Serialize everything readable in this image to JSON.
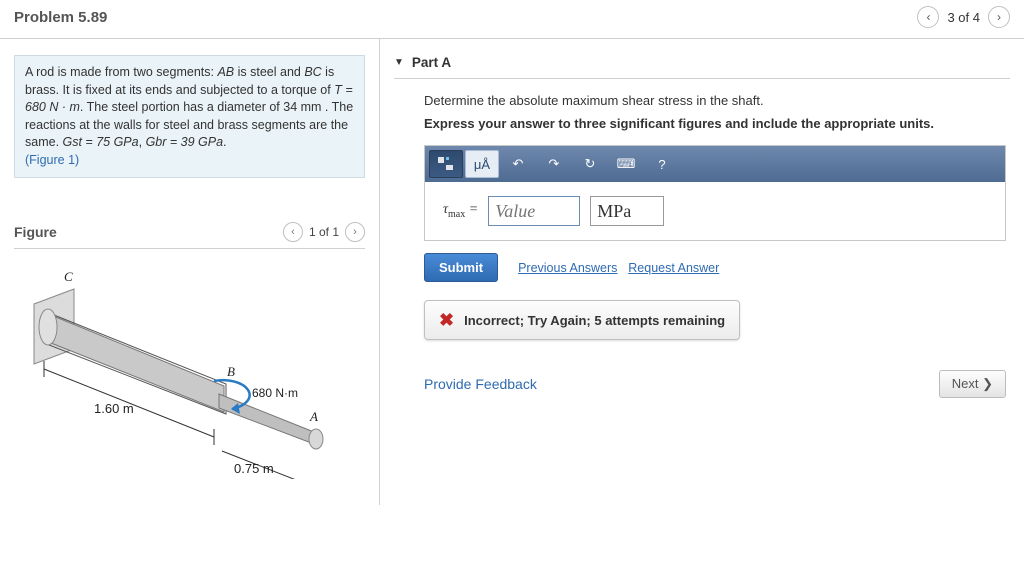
{
  "header": {
    "title": "Problem 5.89",
    "position": "3 of 4"
  },
  "prompt": {
    "pre1": "A rod is made from two segments: ",
    "ab": "AB",
    "mid1": " is steel and ",
    "bc": "BC",
    "mid2": " is brass. It is fixed at its ends and subjected to a torque of ",
    "torque": "T = 680 N · m",
    "mid3": ". The steel portion has a diameter of 34 ",
    "mm": "mm",
    "mid4": " . The reactions at the walls for steel and brass segments are the same. ",
    "gst": "Gst = 75 GPa",
    "comma": ", ",
    "gbr": "Gbr = 39 GPa",
    "period": ".",
    "figlink": "(Figure 1)"
  },
  "figure": {
    "title": "Figure",
    "nav": "1 of 1",
    "labels": {
      "C": "C",
      "B": "B",
      "A": "A",
      "len1": "1.60 m",
      "len2": "0.75 m",
      "torque": "680 N·m"
    }
  },
  "partA": {
    "header": "Part A",
    "instr1": "Determine the absolute maximum shear stress in the shaft.",
    "instr2": "Express your answer to three significant figures and include the appropriate units.",
    "toolbar": {
      "mu": "μÅ",
      "undo": "↶",
      "redo": "↷",
      "reset": "↻",
      "keyboard": "⌨",
      "help": "?"
    },
    "answer": {
      "symbol": "τmax =",
      "value_placeholder": "Value",
      "units": "MPa"
    },
    "submit": "Submit",
    "prev": "Previous Answers",
    "req": "Request Answer",
    "feedback": "Incorrect; Try Again; 5 attempts remaining"
  },
  "bottom": {
    "provide": "Provide Feedback",
    "next": "Next ❯"
  }
}
